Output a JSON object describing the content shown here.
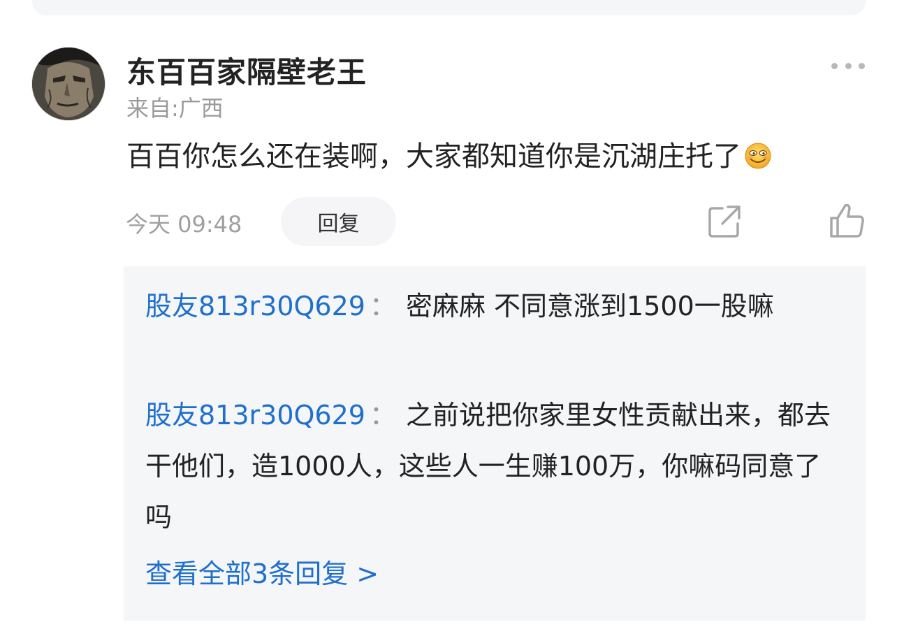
{
  "comment": {
    "username": "东百百家隔壁老王",
    "location": "来自:广西",
    "text": "百百你怎么还在装啊，大家都知道你是沉湖庄托了",
    "time": "今天 09:48",
    "reply_label": "回复",
    "icons": [
      "avatar",
      "more-icon",
      "grin-emoji",
      "share-icon",
      "like-icon"
    ]
  },
  "replies": [
    {
      "nickname": "股友813r30Q629",
      "separator": "：",
      "text": "密麻麻 不同意涨到1500一股嘛"
    },
    {
      "nickname": "股友813r30Q629",
      "separator": "：",
      "text": "之前说把你家里女性贡献出来，都去干他们，造1000人，这些人一生赚100万，你嘛码同意了吗"
    }
  ],
  "view_all": "查看全部3条回复 >",
  "colors": {
    "link_blue": "#1f6fce",
    "meta_gray": "#9a9a9a",
    "reply_bg": "#f5f6f8",
    "text": "#222222"
  }
}
